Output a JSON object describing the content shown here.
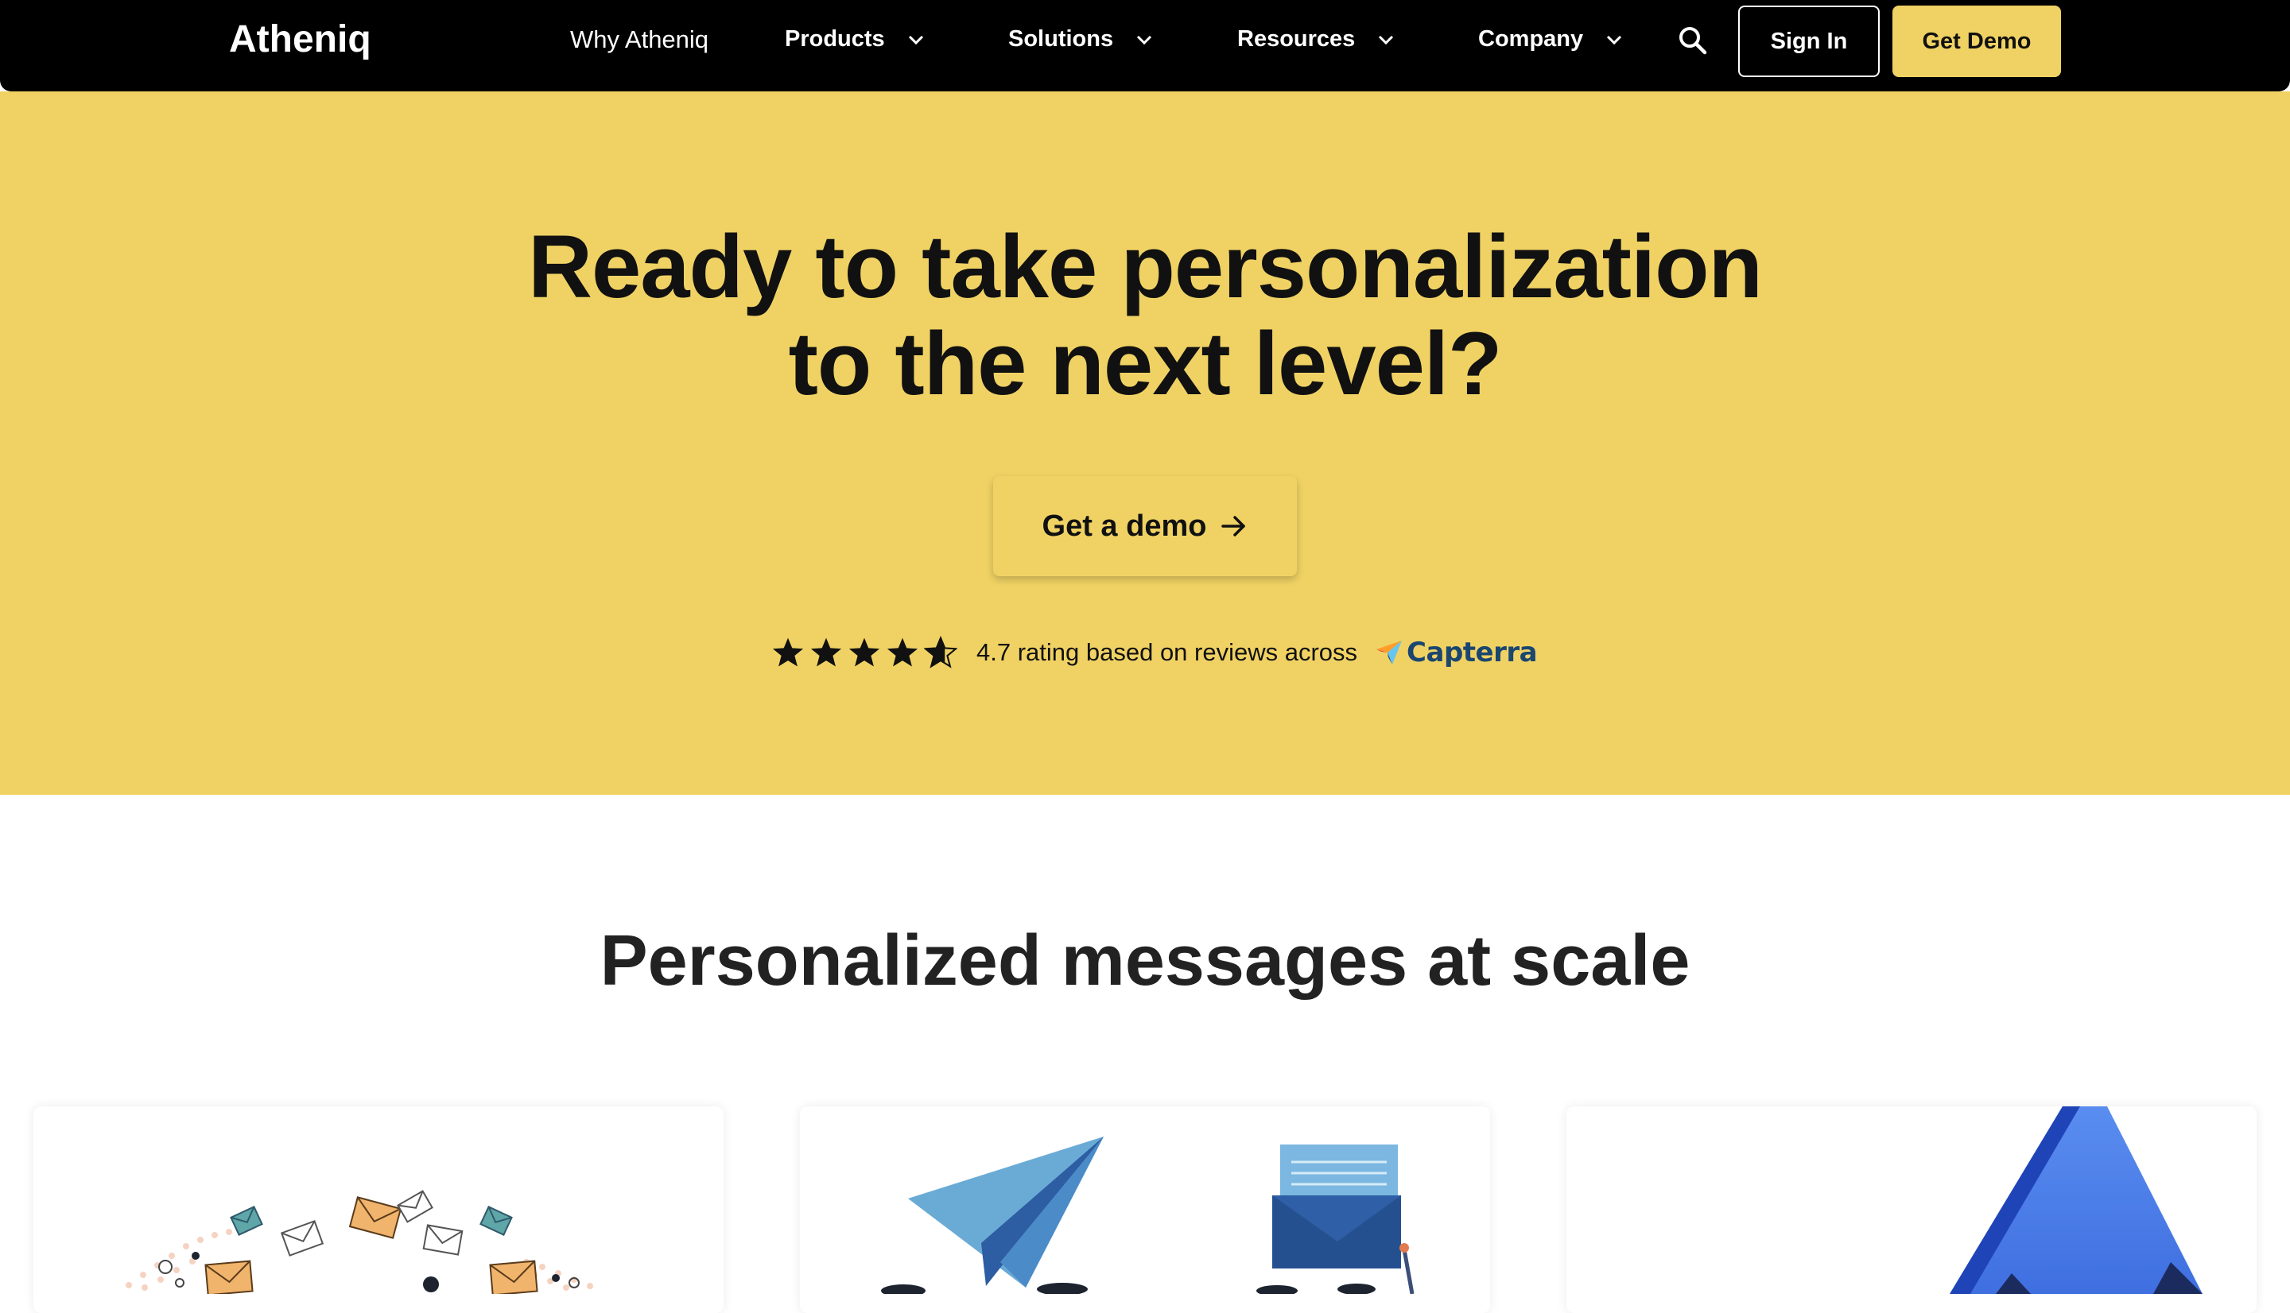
{
  "nav": {
    "logo": "Atheniq",
    "links": [
      {
        "label": "Why Atheniq"
      },
      {
        "label": "Products"
      },
      {
        "label": "Solutions"
      },
      {
        "label": "Resources"
      },
      {
        "label": "Company"
      }
    ],
    "sign_in": "Sign In",
    "get_demo": "Get Demo"
  },
  "hero": {
    "title_line1": "Ready to take personalization",
    "title_line2": "to the next level?",
    "cta_label": "Get a demo",
    "rating_stars": 4.7,
    "rating_text": "4.7 rating based on reviews across",
    "review_site": "Capterra"
  },
  "section": {
    "title": "Personalized messages at scale"
  },
  "colors": {
    "accent": "#f0d264",
    "nav_bg": "#000000",
    "capterra_text": "#1a4670"
  },
  "icons": [
    "search-icon",
    "chevron-down-icon",
    "arrow-right-icon",
    "star-icon",
    "capterra-logo-icon"
  ]
}
